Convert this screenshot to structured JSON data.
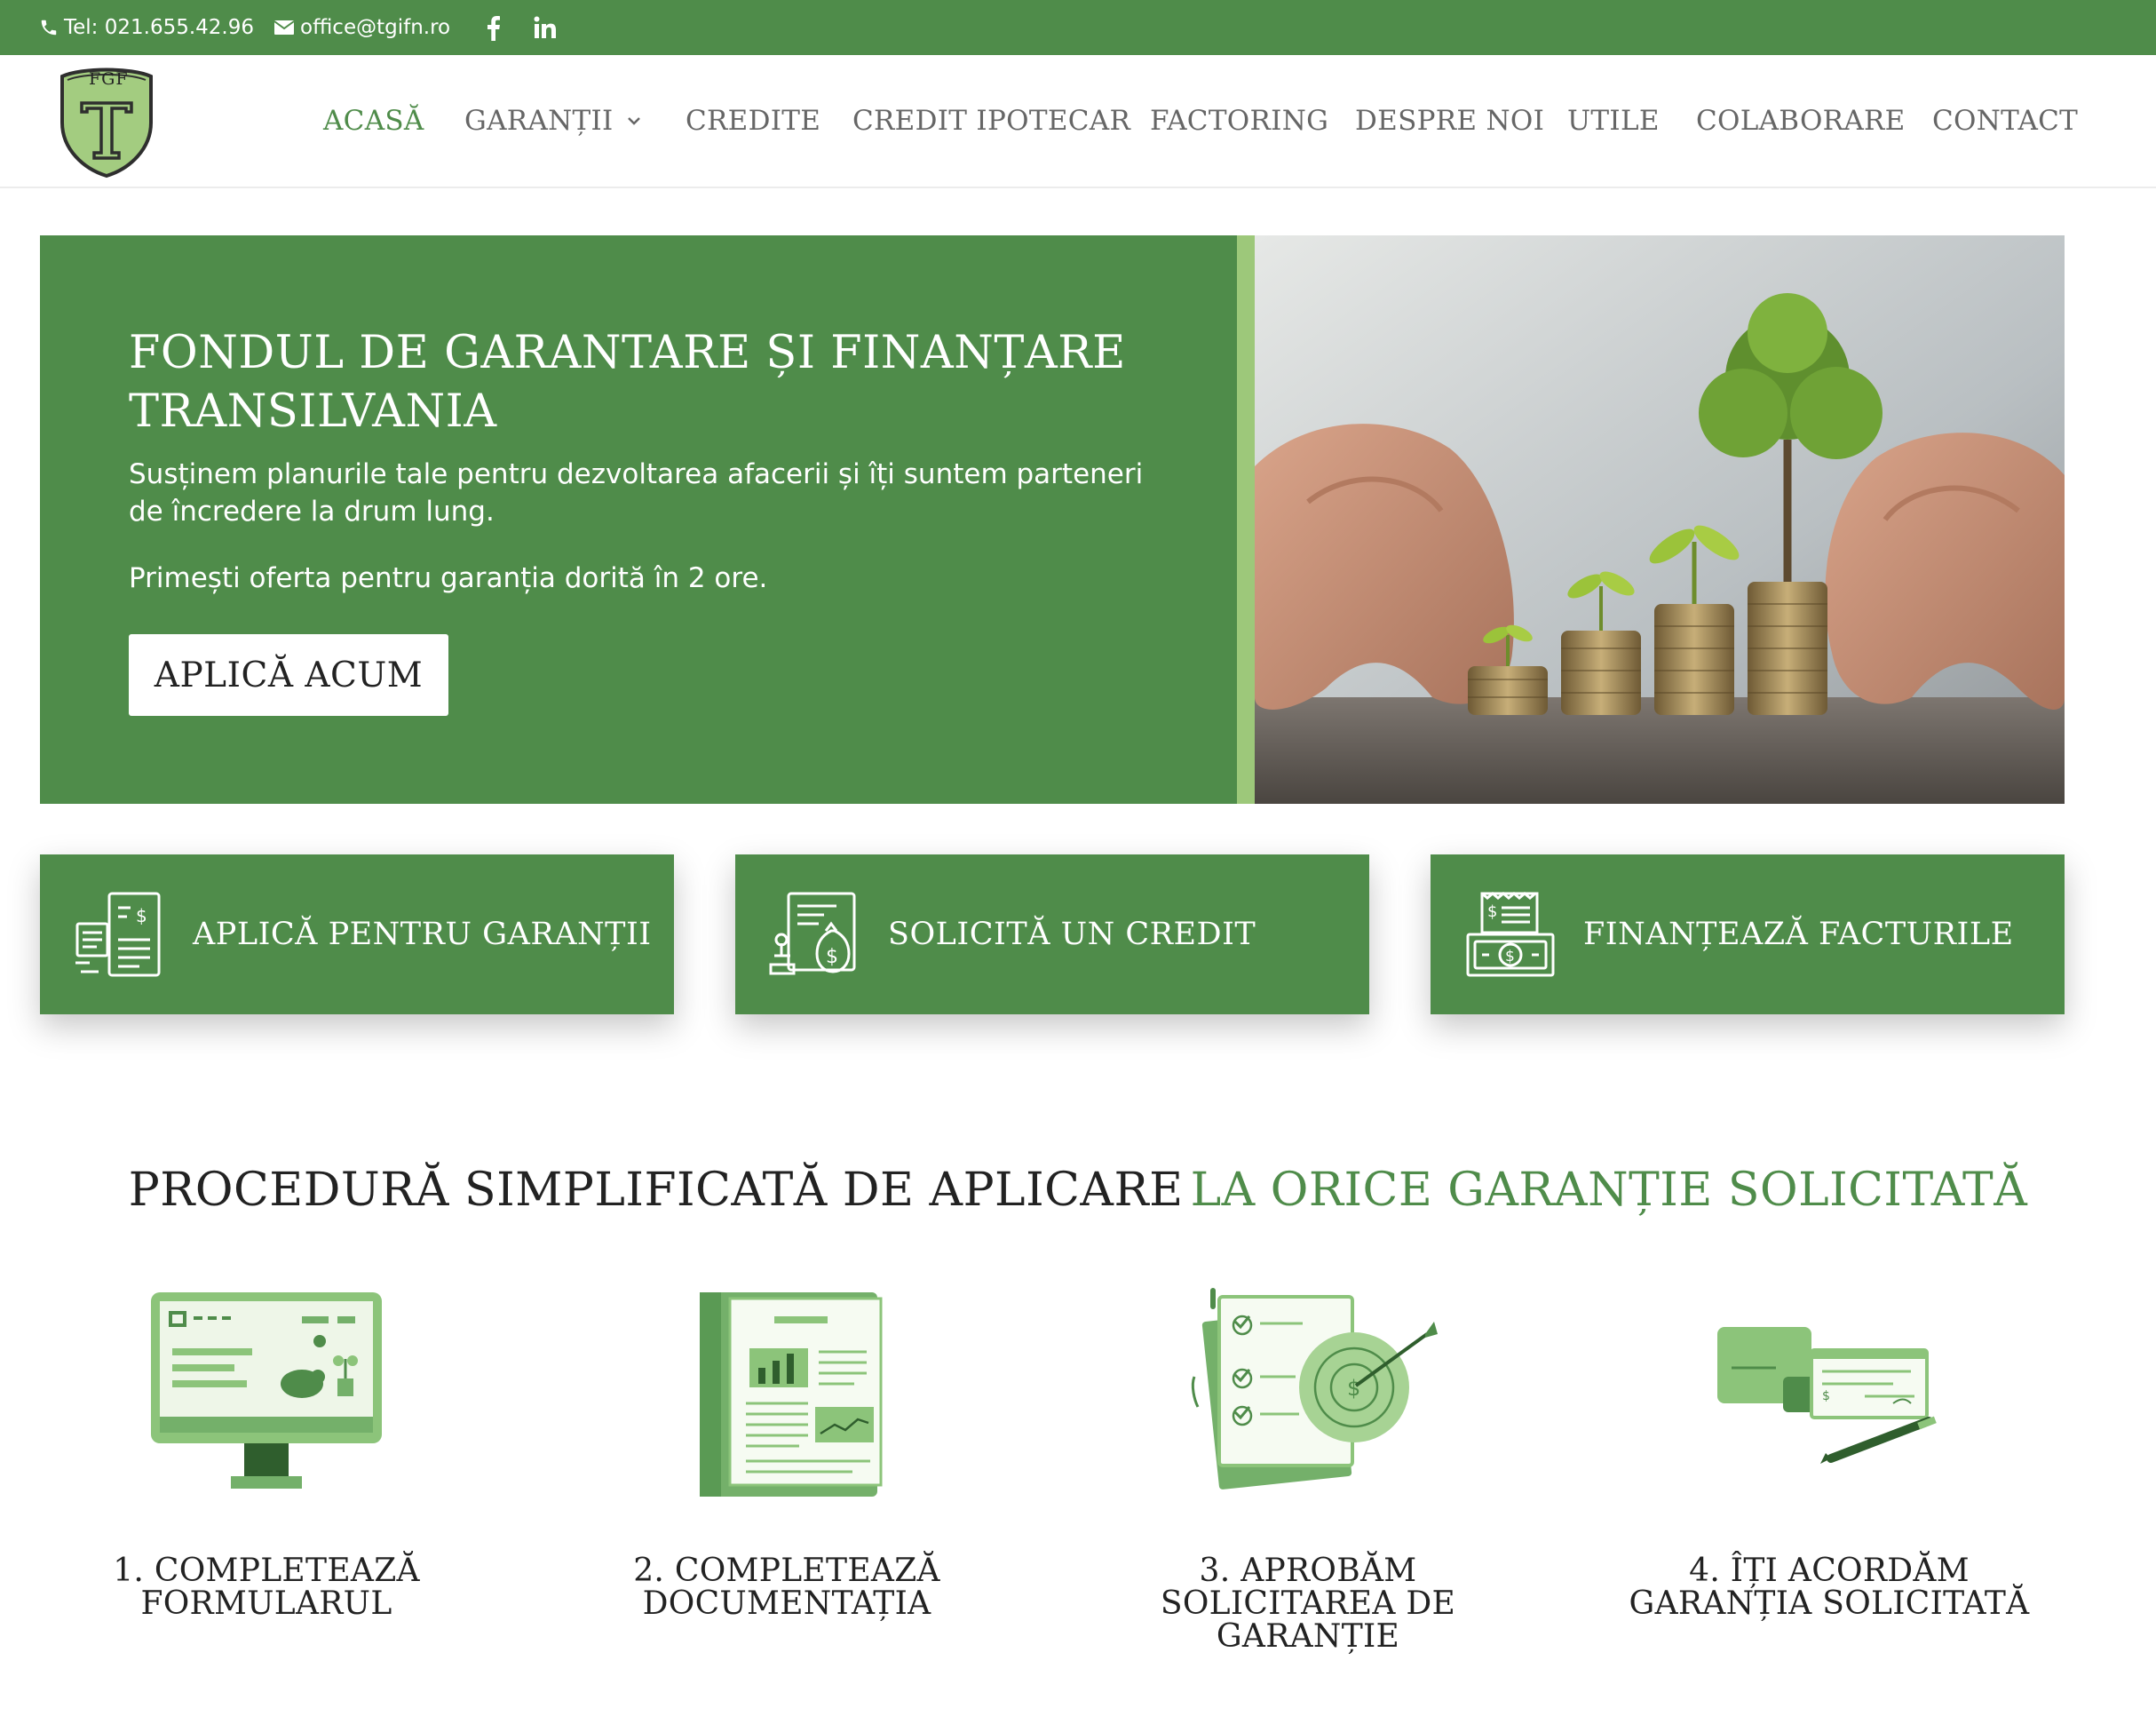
{
  "topbar": {
    "phone": "Tel: 021.655.42.96",
    "email": "office@tgifn.ro",
    "social": [
      "facebook-icon",
      "linkedin-icon"
    ]
  },
  "logo": {
    "text": "FGF",
    "letter": "T"
  },
  "nav": {
    "items": [
      {
        "label": "ACASĂ",
        "active": true
      },
      {
        "label": "GARANȚII",
        "dropdown": true
      },
      {
        "label": "CREDITE"
      },
      {
        "label": "CREDIT IPOTECAR"
      },
      {
        "label": "FACTORING"
      },
      {
        "label": "DESPRE NOI"
      },
      {
        "label": "UTILE"
      },
      {
        "label": "COLABORARE"
      },
      {
        "label": "CONTACT"
      }
    ]
  },
  "hero": {
    "title": "FONDUL DE GARANTARE ȘI FINANȚARE TRANSILVANIA",
    "paragraph1": "Susținem planurile tale pentru dezvoltarea afacerii și îți suntem parteneri de încredere la drum lung.",
    "paragraph2": "Primești oferta pentru garanția dorită în 2 ore.",
    "button_label": "APLICĂ ACUM"
  },
  "cards": [
    {
      "label": "APLICĂ PENTRU GARANȚII",
      "icon": "guarantee-document-icon"
    },
    {
      "label": "SOLICITĂ UN CREDIT",
      "icon": "credit-stamp-icon"
    },
    {
      "label": "FINANȚEAZĂ FACTURILE",
      "icon": "invoice-money-icon"
    }
  ],
  "section": {
    "title_dark": "PROCEDURĂ SIMPLIFICATĂ DE APLICARE",
    "title_green": "LA ORICE GARANȚIE SOLICITATĂ"
  },
  "steps": [
    {
      "label": "1. COMPLETEAZĂ FORMULARUL"
    },
    {
      "label": "2. COMPLETEAZĂ DOCUMENTAȚIA"
    },
    {
      "label": "3. APROBĂM SOLICITAREA DE GARANȚIE"
    },
    {
      "label": "4. ÎȚI ACORDĂM GARANȚIA SOLICITATĂ"
    }
  ],
  "colors": {
    "brand_green": "#4f8c4a",
    "light_green": "#9dc87a",
    "illustration_green": "#8cc47a"
  }
}
